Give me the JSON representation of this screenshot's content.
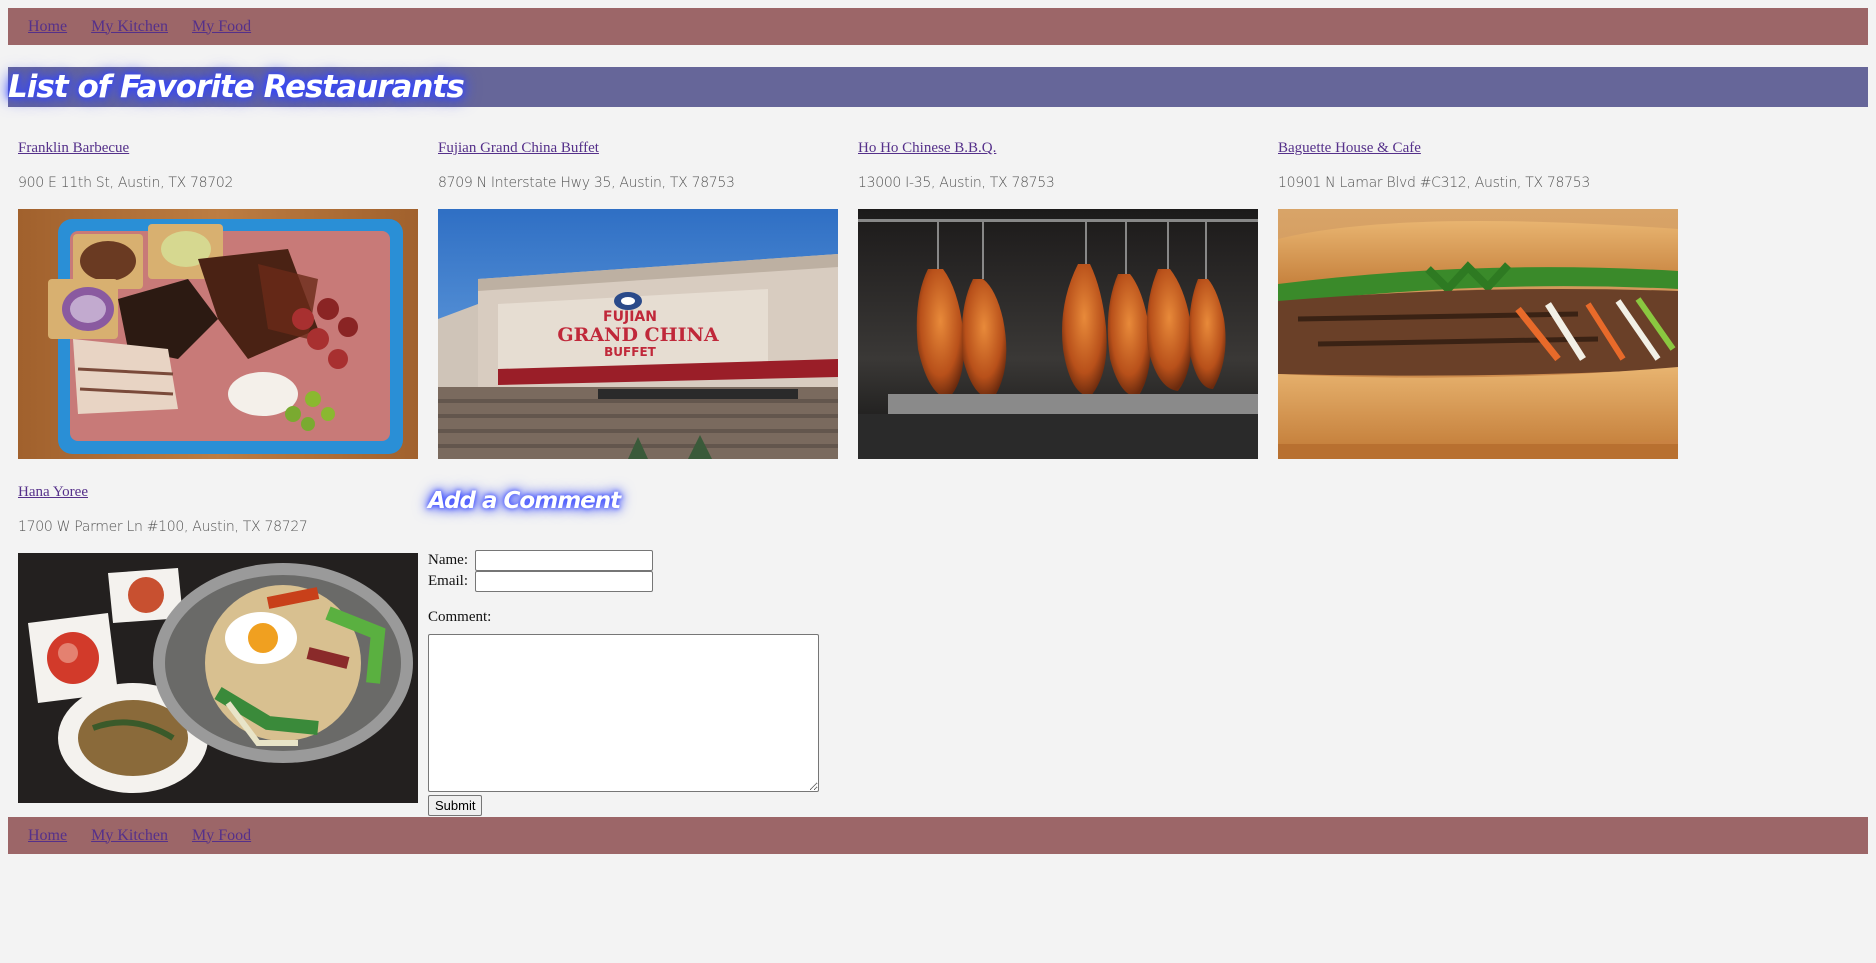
{
  "nav": {
    "links": [
      "Home",
      "My Kitchen",
      "My Food"
    ]
  },
  "header": {
    "title": "List of Favorite Restaurants"
  },
  "restaurants": [
    {
      "name": "Franklin Barbecue",
      "address": "900 E 11th St, Austin, TX 78702"
    },
    {
      "name": "Fujian Grand China Buffet",
      "address": "8709 N Interstate Hwy 35, Austin, TX 78753"
    },
    {
      "name": "Ho Ho Chinese B.B.Q.",
      "address": "13000 I-35, Austin, TX 78753"
    },
    {
      "name": "Baguette House & Cafe",
      "address": "10901 N Lamar Blvd #C312, Austin, TX 78753"
    },
    {
      "name": "Hana Yoree",
      "address": "1700 W Parmer Ln #100, Austin, TX 78727"
    }
  ],
  "sign": {
    "line1": "FUJIAN",
    "line2": "GRAND CHINA",
    "line3": "BUFFET"
  },
  "comment_form": {
    "title": "Add a Comment",
    "name_label": "Name:",
    "email_label": "Email:",
    "comment_label": "Comment:",
    "name_value": "",
    "email_value": "",
    "comment_value": "",
    "submit_label": "Submit"
  },
  "colors": {
    "nav_bg": "#9c6668",
    "banner_bg": "#666699",
    "link": "#55308a",
    "page_bg": "#f3f3f3",
    "title_glow": "#3344ff"
  }
}
